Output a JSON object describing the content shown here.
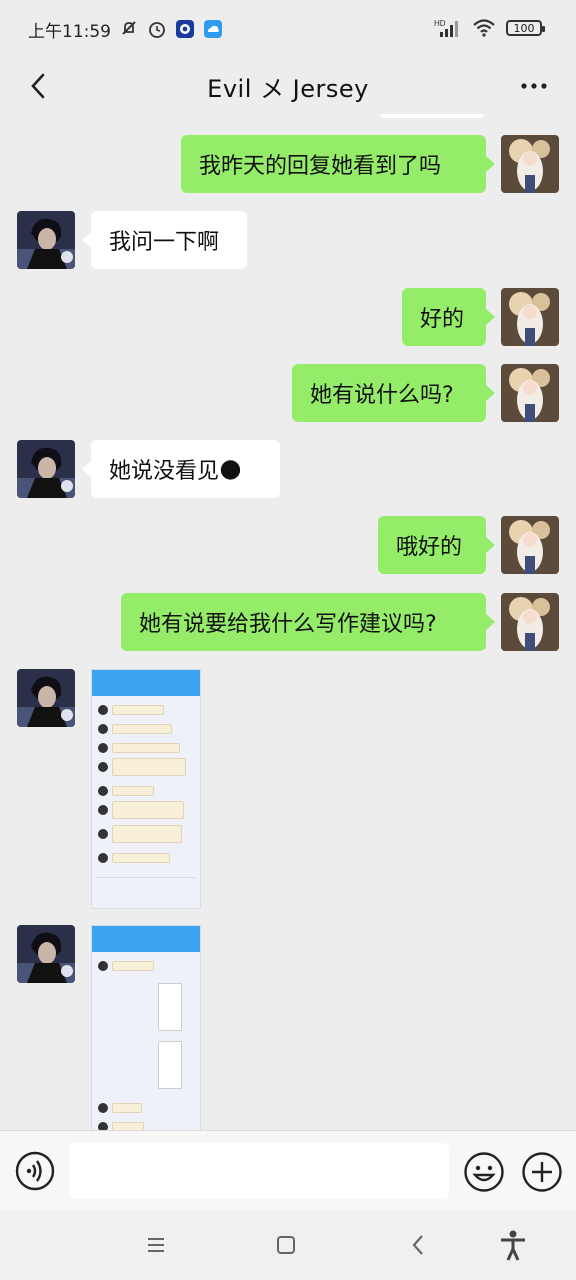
{
  "status_bar": {
    "time": "上午11:59",
    "battery": "100",
    "signal_label": "HD"
  },
  "nav": {
    "title": "Evil メ Jersey"
  },
  "messages": [
    {
      "side": "me",
      "text": "我昨天的回复她看到了吗"
    },
    {
      "side": "them",
      "text": "我问一下啊"
    },
    {
      "side": "me",
      "text": "好的"
    },
    {
      "side": "me",
      "text": "她有说什么吗?"
    },
    {
      "side": "them",
      "text": "她说没看见🌑"
    },
    {
      "side": "me",
      "text": "哦好的"
    },
    {
      "side": "me",
      "text": "她有说要给我什么写作建议吗?"
    },
    {
      "side": "them",
      "type": "image",
      "text": ""
    },
    {
      "side": "them",
      "type": "image",
      "text": ""
    }
  ],
  "input": {
    "placeholder": ""
  },
  "colors": {
    "my_bubble": "#95ec69",
    "their_bubble": "#ffffff",
    "background": "#ededed"
  },
  "icons": [
    "back-icon",
    "more-icon",
    "voice-icon",
    "emoji-icon",
    "plus-icon",
    "menu-icon",
    "home-icon",
    "back-nav-icon",
    "accessibility-icon"
  ]
}
